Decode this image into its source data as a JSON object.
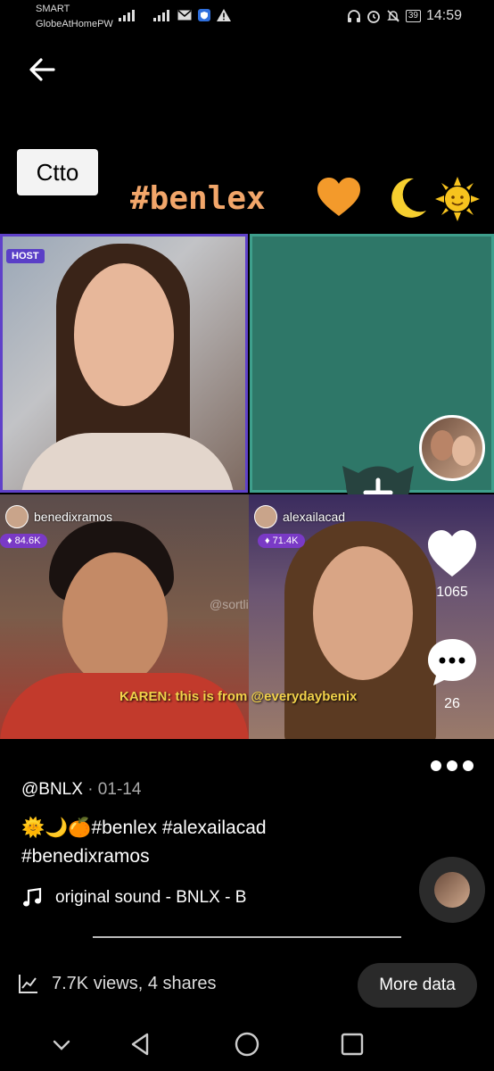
{
  "status_bar": {
    "carrier_line1": "SMART",
    "carrier_line2": "GlobeAtHomePW",
    "network": "4G",
    "battery": "39",
    "time": "14:59"
  },
  "video": {
    "ctto_label": "Ctto",
    "hashtag_title": "#benlex",
    "host_badge": "HOST",
    "tile_left_user": "benedixramos",
    "tile_left_count": "84.6K",
    "tile_right_user": "alexailacad",
    "tile_right_count": "71.4K",
    "watermark": "@sortlitz",
    "comment_overlay": "KAREN: this is from @everydaybenix"
  },
  "rail": {
    "like_count": "1065",
    "comment_count": "26"
  },
  "post": {
    "author": "@BNLX",
    "date": "· 01-14",
    "caption_line1": "🌞🌙🍊#benlex #alexailacad",
    "caption_line2": "#benedixramos",
    "sound": "original sound - BNLX - B"
  },
  "stats": {
    "views_shares": "7.7K views, 4 shares",
    "more_data_label": "More data"
  },
  "colors": {
    "host_border": "#5f41c9",
    "empty_slot": "#2e7768",
    "hashtag": "#f2a66a"
  }
}
